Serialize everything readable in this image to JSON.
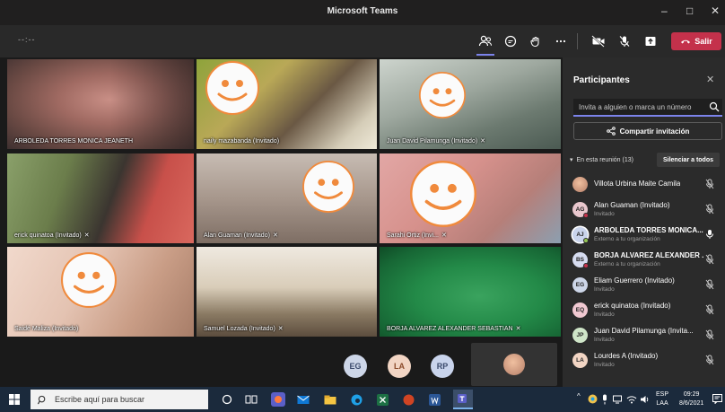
{
  "window": {
    "title": "Microsoft Teams",
    "minimize": "–",
    "maximize": "□",
    "close": "✕"
  },
  "meeting": {
    "timer": "--:--",
    "leave_label": "Salir",
    "toolbar_icons": [
      "participants-icon",
      "chat-icon",
      "reactions-icon",
      "more-icon",
      "camera-off-icon",
      "mic-off-icon",
      "share-tray-icon"
    ]
  },
  "tiles": [
    {
      "name": "ARBOLEDA TORRES MONICA JEANETH",
      "mic_muted": false
    },
    {
      "name": "naily mazabanda (Invitado)",
      "mic_muted": false
    },
    {
      "name": "Juan David Pilamunga (Invitado)",
      "mic_muted": true
    },
    {
      "name": "erick quinatoa (Invitado)",
      "mic_muted": true
    },
    {
      "name": "Alan Guaman (Invitado)",
      "mic_muted": true
    },
    {
      "name": "Sarahi Ortiz (Invi...",
      "mic_muted": true
    },
    {
      "name": "Saidé Maliza (Invitado)",
      "mic_muted": false
    },
    {
      "name": "Samuel Lozada (Invitado)",
      "mic_muted": true
    },
    {
      "name": "BORJA ALVAREZ ALEXANDER SEBASTIAN",
      "mic_muted": true
    }
  ],
  "overflow_avatars": [
    {
      "initials": "EG",
      "color": "#cdd6e8"
    },
    {
      "initials": "LA",
      "color": "#f2d5c4"
    },
    {
      "initials": "RP",
      "color": "#c9d4ec"
    }
  ],
  "panel": {
    "title": "Participantes",
    "invite_placeholder": "Invita a alguien o marca un número",
    "share_label": "Compartir invitación",
    "section_label": "En esta reunión (13)",
    "mute_all_label": "Silenciar a todos",
    "participants": [
      {
        "initials": "",
        "name": "Villota Urbina Maite Camila",
        "role": "",
        "color": "#f0c0a0",
        "bold": false,
        "mic": "off"
      },
      {
        "initials": "AG",
        "name": "Alan Guaman (Invitado)",
        "role": "Invitado",
        "color": "#e9c7cd",
        "bold": false,
        "mic": "off"
      },
      {
        "initials": "AJ",
        "name": "ARBOLEDA TORRES MONICA...",
        "role": "Externo a tu organización",
        "color": "#c9d4ec",
        "bold": true,
        "mic": "on"
      },
      {
        "initials": "BS",
        "name": "BORJA ALVAREZ ALEXANDER ...",
        "role": "Externo a tu organización",
        "color": "#d6dcf0",
        "bold": true,
        "mic": "off"
      },
      {
        "initials": "EG",
        "name": "Eliam Guerrero (Invitado)",
        "role": "Invitado",
        "color": "#cdd6e8",
        "bold": false,
        "mic": "off"
      },
      {
        "initials": "EQ",
        "name": "erick quinatoa (Invitado)",
        "role": "Invitado",
        "color": "#f1c9d2",
        "bold": false,
        "mic": "off"
      },
      {
        "initials": "JP",
        "name": "Juan David Pilamunga (Invita...",
        "role": "Invitado",
        "color": "#cfe5c8",
        "bold": false,
        "mic": "off"
      },
      {
        "initials": "LA",
        "name": "Lourdes A (Invitado)",
        "role": "Invitado",
        "color": "#f2d5c4",
        "bold": false,
        "mic": "off"
      }
    ]
  },
  "taskbar": {
    "search_placeholder": "Escribe aquí para buscar",
    "lang_top": "ESP",
    "lang_bottom": "LAA",
    "time": "09:29",
    "date": "8/6/2021"
  }
}
